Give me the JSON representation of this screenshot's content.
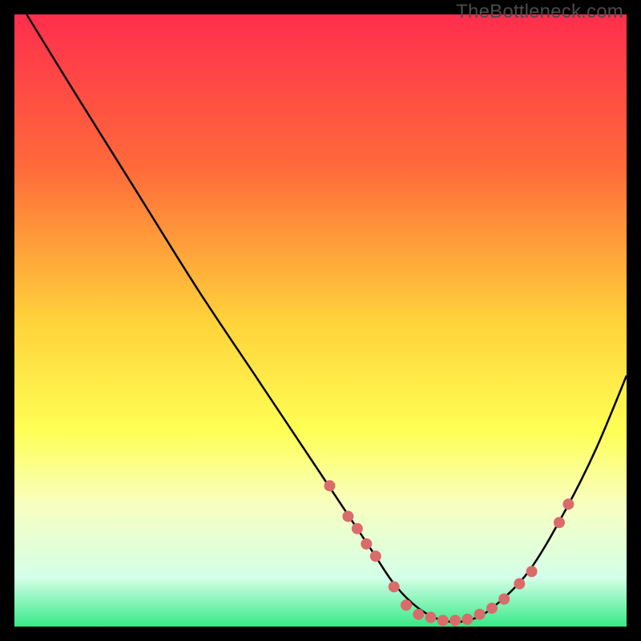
{
  "watermark": "TheBottleneck.com",
  "chart_data": {
    "type": "line",
    "title": "",
    "xlabel": "",
    "ylabel": "",
    "xlim": [
      0,
      100
    ],
    "ylim": [
      0,
      100
    ],
    "gradient_stops": [
      {
        "offset": 0,
        "color": "#ff2e4d"
      },
      {
        "offset": 0.25,
        "color": "#ff6a3a"
      },
      {
        "offset": 0.5,
        "color": "#ffd23a"
      },
      {
        "offset": 0.68,
        "color": "#ffff55"
      },
      {
        "offset": 0.8,
        "color": "#f7ffc0"
      },
      {
        "offset": 0.92,
        "color": "#d4ffe8"
      },
      {
        "offset": 1.0,
        "color": "#37e987"
      }
    ],
    "series": [
      {
        "name": "bottleneck-curve",
        "type": "line",
        "x": [
          2,
          10,
          20,
          30,
          40,
          50,
          58,
          62,
          66,
          70,
          74,
          78,
          84,
          90,
          95,
          100
        ],
        "y": [
          100,
          87,
          71,
          55,
          40,
          25,
          13,
          7,
          3,
          1,
          1,
          3,
          9,
          19,
          29,
          41
        ]
      },
      {
        "name": "highlight-points",
        "type": "scatter",
        "color": "#da6b6b",
        "x": [
          51.5,
          54.5,
          56,
          57.5,
          59,
          62,
          64,
          66,
          68,
          70,
          72,
          74,
          76,
          78,
          80,
          82.5,
          84.5,
          89,
          90.5
        ],
        "y": [
          23,
          18,
          16,
          13.5,
          11.5,
          6.5,
          3.5,
          2,
          1.5,
          1,
          1,
          1.2,
          2,
          3,
          4.5,
          7,
          9,
          17,
          20
        ]
      }
    ]
  }
}
